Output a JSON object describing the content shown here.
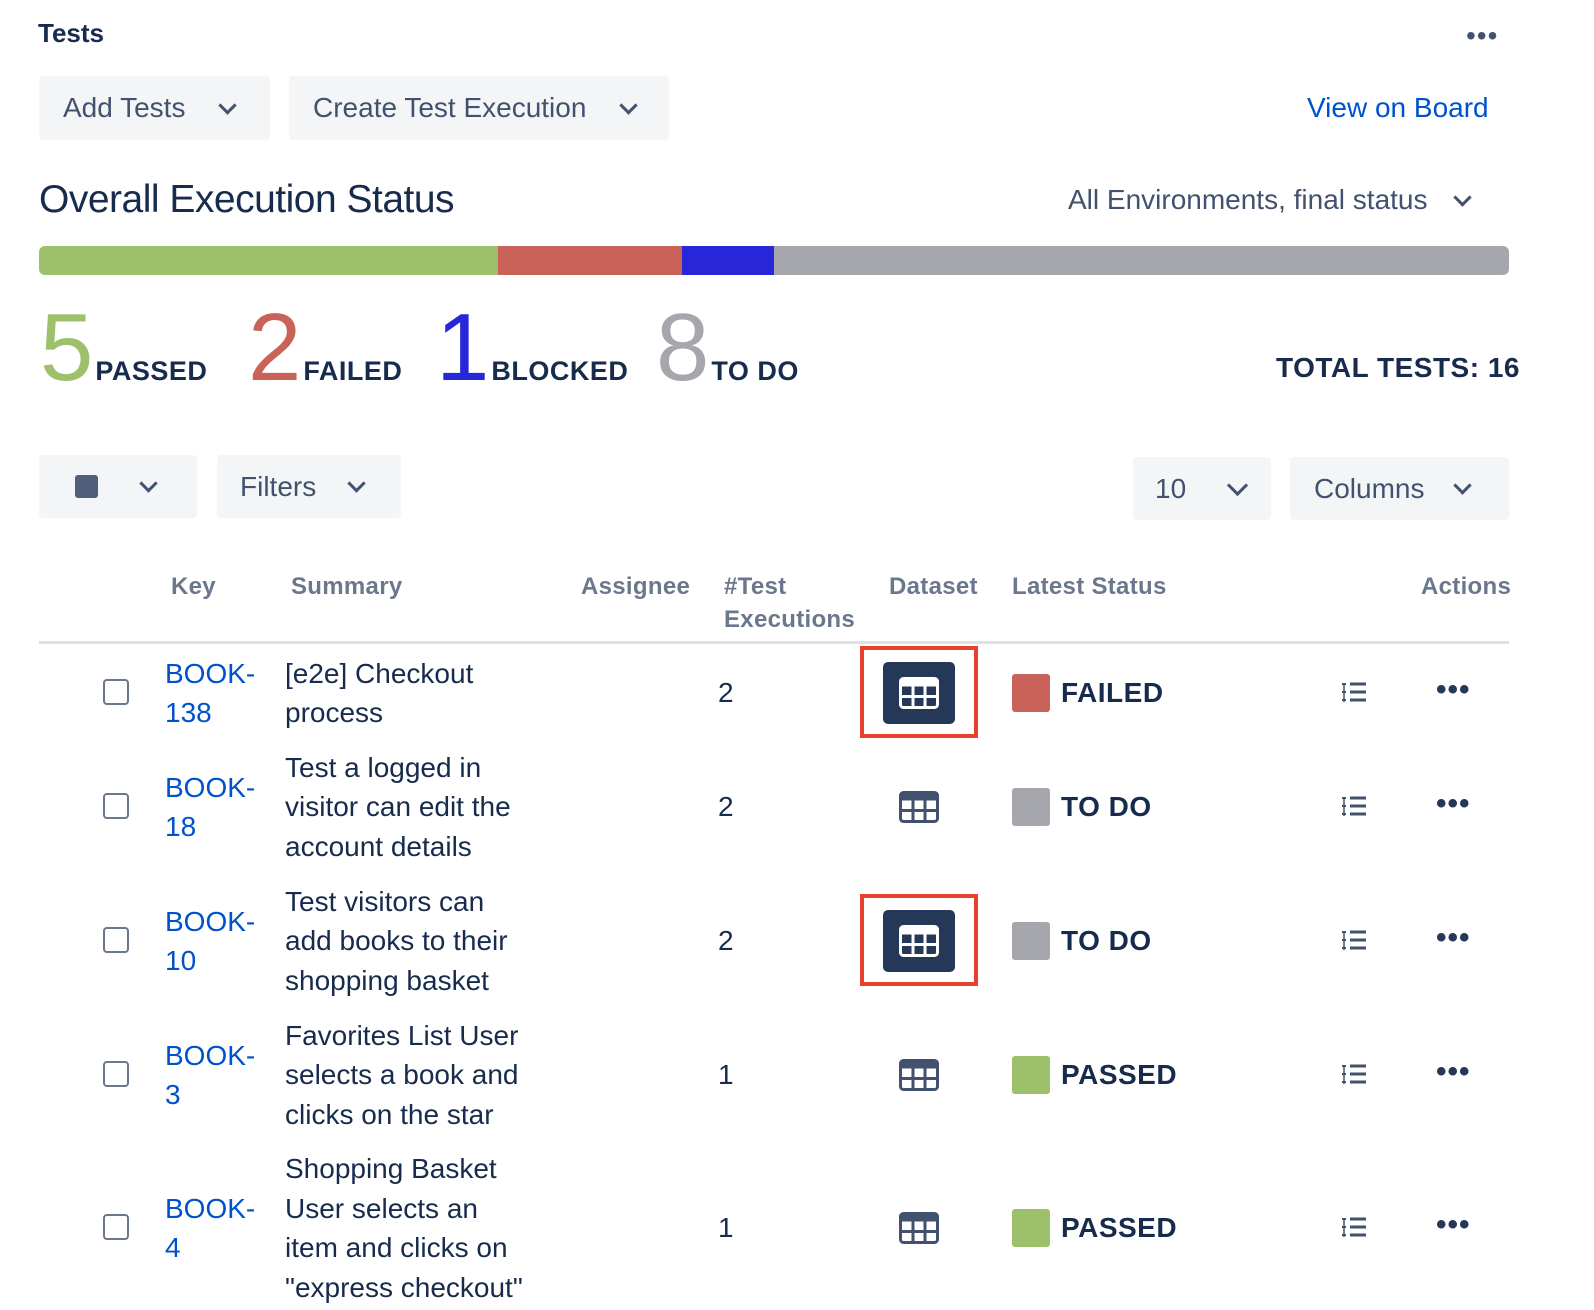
{
  "panel": {
    "title": "Tests",
    "more_icon": "more-horizontal-icon"
  },
  "toolbar": {
    "add_tests_label": "Add Tests",
    "create_execution_label": "Create Test Execution",
    "view_board_label": "View on Board"
  },
  "overview": {
    "title": "Overall Execution Status",
    "environment_select": "All Environments, final status",
    "stats": [
      {
        "count": "5",
        "label": "PASSED",
        "color": "#9cc16a"
      },
      {
        "count": "2",
        "label": "FAILED",
        "color": "#c9635a"
      },
      {
        "count": "1",
        "label": "BLOCKED",
        "color": "#2727d9"
      },
      {
        "count": "8",
        "label": "TO DO",
        "color": "#a5a7ac"
      }
    ],
    "total_label": "TOTAL TESTS: 16",
    "bar_colors": {
      "passed": "#9cc16a",
      "failed": "#c9635a",
      "blocked": "#2727d9",
      "todo": "#a5a7ac"
    }
  },
  "controls": {
    "filters_label": "Filters",
    "page_size": "10",
    "columns_label": "Columns"
  },
  "table": {
    "headers": {
      "key": "Key",
      "summary": "Summary",
      "assignee": "Assignee",
      "executions_line1": "#Test",
      "executions_line2": "Executions",
      "dataset": "Dataset",
      "latest_status": "Latest Status",
      "actions": "Actions"
    },
    "rows": [
      {
        "key_line1": "BOOK-",
        "key_line2": "138",
        "summary_lines": [
          "[e2e] Checkout",
          "process"
        ],
        "executions": "2",
        "status": "FAILED",
        "status_color": "#c9635a",
        "dataset_active": true
      },
      {
        "key_line1": "BOOK-",
        "key_line2": "18",
        "summary_lines": [
          "Test a logged in",
          "visitor can edit the",
          "account details"
        ],
        "executions": "2",
        "status": "TO DO",
        "status_color": "#a5a7ac",
        "dataset_active": false
      },
      {
        "key_line1": "BOOK-",
        "key_line2": "10",
        "summary_lines": [
          "Test visitors can",
          "add books to their",
          "shopping basket"
        ],
        "executions": "2",
        "status": "TO DO",
        "status_color": "#a5a7ac",
        "dataset_active": true
      },
      {
        "key_line1": "BOOK-",
        "key_line2": "3",
        "summary_lines": [
          "Favorites List User",
          "selects a book and",
          "clicks on the star"
        ],
        "executions": "1",
        "status": "PASSED",
        "status_color": "#9cc16a",
        "dataset_active": false
      },
      {
        "key_line1": "BOOK-",
        "key_line2": "4",
        "summary_lines": [
          "Shopping Basket",
          "User selects an",
          "item and clicks on",
          "\"express checkout\""
        ],
        "executions": "1",
        "status": "PASSED",
        "status_color": "#9cc16a",
        "dataset_active": false
      }
    ]
  },
  "icons": {
    "dataset": "dataset-grid-icon",
    "test_steps": "test-steps-list-icon",
    "row_more": "more-horizontal-icon",
    "dropdown": "chevron-down-icon"
  }
}
